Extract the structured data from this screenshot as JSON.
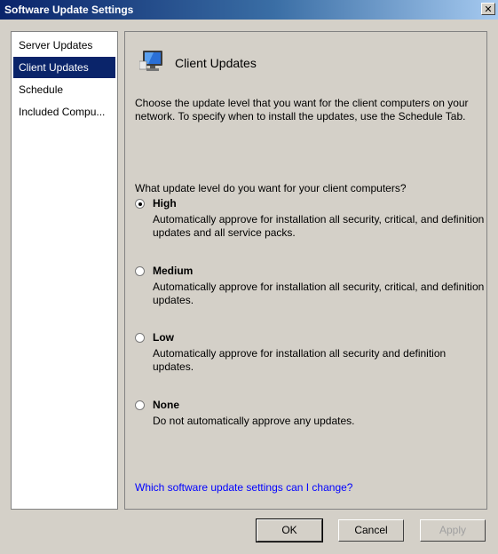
{
  "window": {
    "title": "Software Update Settings",
    "close_glyph": "✕"
  },
  "sidebar": {
    "items": [
      {
        "label": "Server Updates",
        "selected": false
      },
      {
        "label": "Client Updates",
        "selected": true
      },
      {
        "label": "Schedule",
        "selected": false
      },
      {
        "label": "Included Compu...",
        "selected": false
      }
    ]
  },
  "panel": {
    "header_title": "Client Updates",
    "header_icon": "monitor-icon",
    "intro": "Choose the update level that you want for the client computers on your network. To specify when to install the updates, use the Schedule Tab.",
    "question": "What update level do you want for your client computers?",
    "options": [
      {
        "label": "High",
        "description": "Automatically approve for installation all security, critical, and definition updates and all service packs.",
        "checked": true
      },
      {
        "label": "Medium",
        "description": "Automatically approve for installation all security, critical, and definition updates.",
        "checked": false
      },
      {
        "label": "Low",
        "description": "Automatically approve for installation all security and definition updates.",
        "checked": false
      },
      {
        "label": "None",
        "description": "Do not automatically approve any updates.",
        "checked": false
      }
    ],
    "help_link": "Which software update settings can I change?"
  },
  "buttons": {
    "ok": "OK",
    "cancel": "Cancel",
    "apply": "Apply"
  },
  "colors": {
    "selection": "#0a246a",
    "link": "#0000ff",
    "title_bar": "#0a246a"
  }
}
